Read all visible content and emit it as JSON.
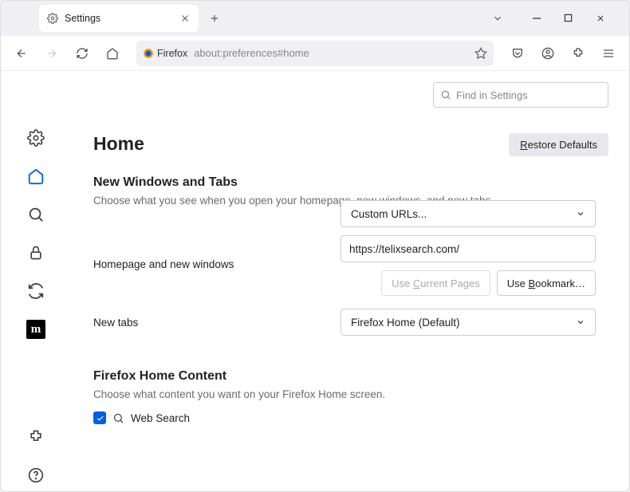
{
  "tab": {
    "title": "Settings"
  },
  "urlbar": {
    "badge": "Firefox",
    "url": "about:preferences#home"
  },
  "find": {
    "placeholder": "Find in Settings"
  },
  "page": {
    "title": "Home",
    "restore": "Restore Defaults",
    "section1": {
      "title": "New Windows and Tabs",
      "desc": "Choose what you see when you open your homepage, new windows, and new tabs.",
      "homepage_label": "Homepage and new windows",
      "homepage_select": "Custom URLs...",
      "homepage_url": "https://telixsearch.com/",
      "use_current": "Use Current Pages",
      "use_bookmark": "Use Bookmark…",
      "newtabs_label": "New tabs",
      "newtabs_select": "Firefox Home (Default)"
    },
    "section2": {
      "title": "Firefox Home Content",
      "desc": "Choose what content you want on your Firefox Home screen.",
      "websearch": "Web Search"
    }
  }
}
